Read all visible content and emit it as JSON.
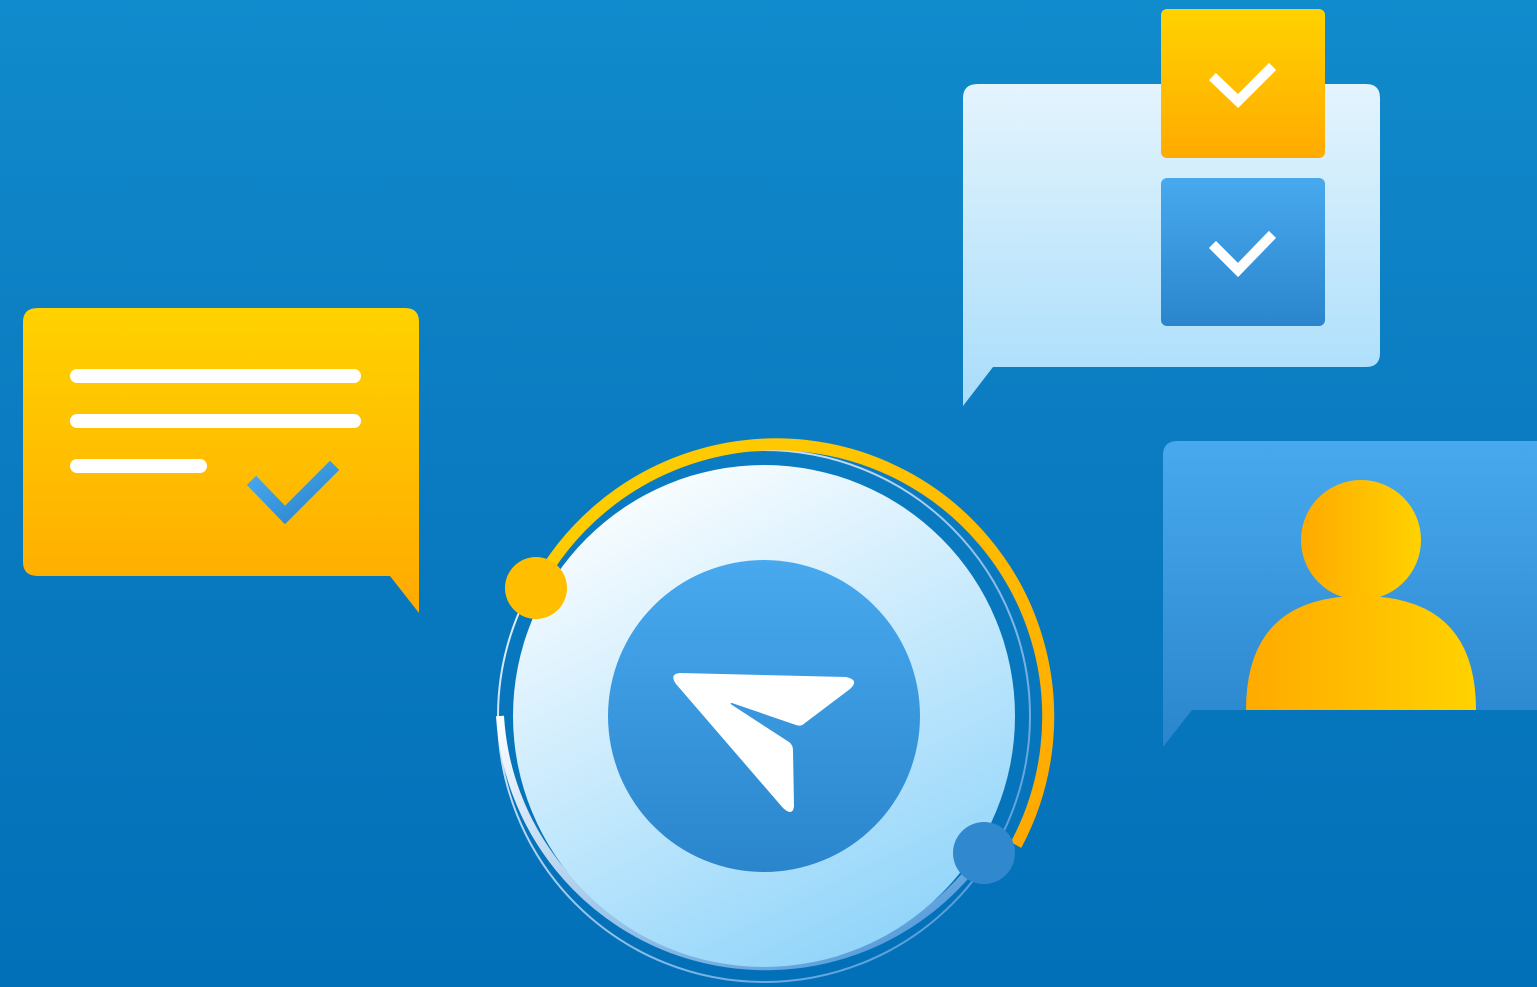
{
  "scene": {
    "description_label": "",
    "colors": {
      "background_top": "#108BCC",
      "background_bottom": "#0270B8",
      "yellow_top": "#FFD200",
      "yellow_bottom": "#FFAA00",
      "blue_light": "#48A9EF",
      "blue_dark": "#2A85CC",
      "pale_top": "#E4F4FD",
      "pale_bottom": "#A8DDFB",
      "white": "#FFFFFF"
    },
    "icons": [
      "message-bubble-icon",
      "checklist-bubble-icon",
      "send-icon",
      "user-icon",
      "checkmark-icon"
    ]
  }
}
